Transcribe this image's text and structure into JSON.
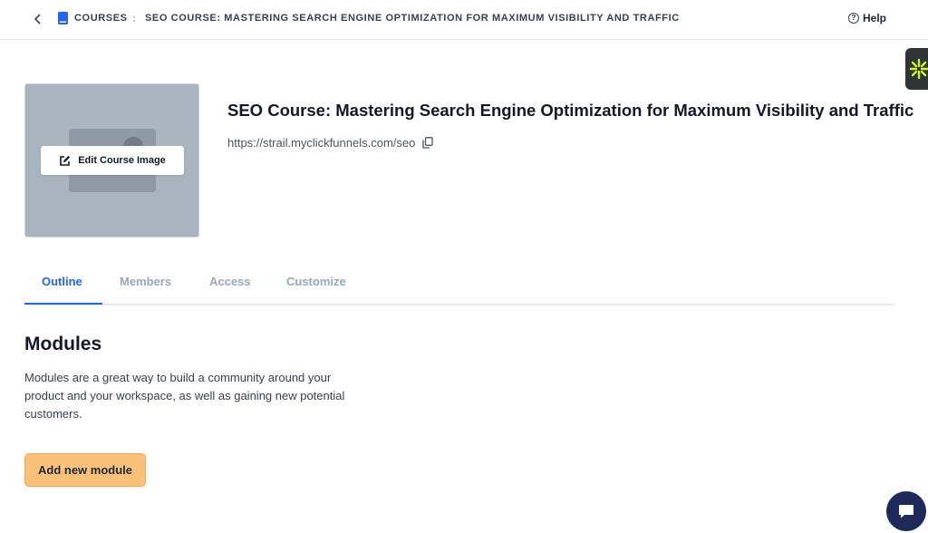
{
  "header": {
    "breadcrumb_courses": "COURSES",
    "breadcrumb_separator": ":",
    "breadcrumb_title": "SEO COURSE: MASTERING SEARCH ENGINE OPTIMIZATION FOR MAXIMUM VISIBILITY AND TRAFFIC",
    "help_label": "Help",
    "help_icon_glyph": "?"
  },
  "course": {
    "edit_image_label": "Edit Course Image",
    "title": "SEO Course: Mastering Search Engine Optimization for Maximum Visibility and Traffic",
    "url": "https://strail.myclickfunnels.com/seo"
  },
  "tabs": [
    {
      "label": "Outline",
      "active": true
    },
    {
      "label": "Members",
      "active": false
    },
    {
      "label": "Access",
      "active": false
    },
    {
      "label": "Customize",
      "active": false
    }
  ],
  "modules": {
    "heading": "Modules",
    "description": "Modules are a great way to build a community around your product and your workspace, as well as gaining new potential customers.",
    "add_button_label": "Add new module"
  },
  "icons": {
    "back": "chevron-left-icon",
    "courses": "book-icon",
    "help": "question-circle-icon",
    "edit": "edit-square-icon",
    "copy": "copy-icon",
    "widget": "sparkle-icon",
    "chat": "chat-bubble-icon"
  },
  "colors": {
    "accent": "#2563eb",
    "add_button": "#fbc17a",
    "chat_button": "#1e2a5a",
    "widget_bg": "#2f3437",
    "widget_glyph": "#d4f22a"
  }
}
